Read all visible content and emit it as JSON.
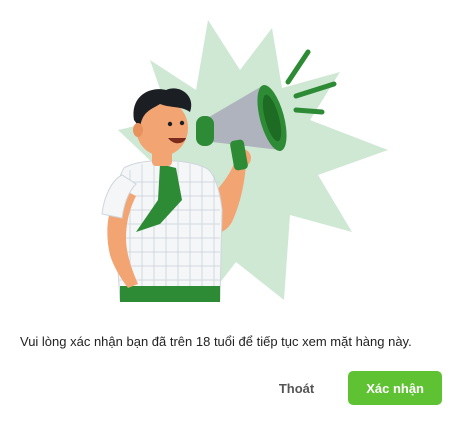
{
  "dialog": {
    "message": "Vui lòng xác nhận bạn đã trên 18 tuổi để tiếp tục xem mặt hàng này.",
    "exit_label": "Thoát",
    "confirm_label": "Xác nhận",
    "accent_color": "#5fc233",
    "illustration": "man-with-megaphone-illustration"
  }
}
